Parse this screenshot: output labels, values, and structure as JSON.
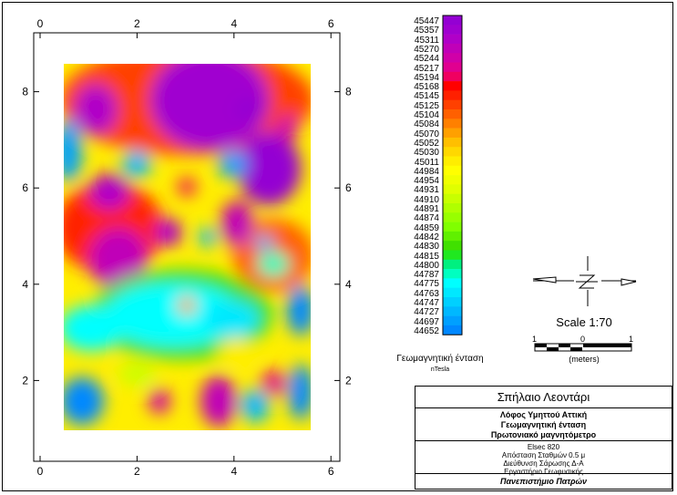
{
  "map": {
    "x_ticks": [
      "0",
      "2",
      "4",
      "6"
    ],
    "y_ticks": [
      "2",
      "4",
      "6",
      "8"
    ],
    "x_range": [
      0,
      6
    ],
    "y_range": [
      0,
      9
    ],
    "data_extent": {
      "x": [
        0.5,
        5.6
      ],
      "y": [
        0.9,
        8.6
      ]
    }
  },
  "legend": {
    "values": [
      "45447",
      "45357",
      "45311",
      "45270",
      "45244",
      "45217",
      "45194",
      "45168",
      "45145",
      "45125",
      "45104",
      "45084",
      "45070",
      "45052",
      "45030",
      "45011",
      "44984",
      "44954",
      "44931",
      "44910",
      "44891",
      "44874",
      "44859",
      "44842",
      "44830",
      "44815",
      "44800",
      "44787",
      "44775",
      "44763",
      "44747",
      "44727",
      "44697",
      "44652"
    ],
    "colors": [
      "#9400d3",
      "#a000d0",
      "#b000c8",
      "#c000b8",
      "#d000a8",
      "#e00090",
      "#f00060",
      "#ff0000",
      "#ff2000",
      "#ff4000",
      "#ff6000",
      "#ff8000",
      "#ffa000",
      "#ffbf00",
      "#ffd800",
      "#ffee00",
      "#ffff00",
      "#f0ff00",
      "#e0ff00",
      "#c8ff00",
      "#b0ff00",
      "#98ff00",
      "#80ff00",
      "#60f000",
      "#40e000",
      "#20e820",
      "#00f080",
      "#00ffc0",
      "#00ffff",
      "#00e8ff",
      "#00d0ff",
      "#00b8ff",
      "#00a0ff",
      "#0088ff"
    ],
    "title": "Γεωμαγνητική ένταση",
    "unit": "nTesla"
  },
  "north_arrow": {
    "label": "N"
  },
  "scale": {
    "text": "Scale 1:70",
    "labels": [
      "1",
      "0",
      "1"
    ],
    "unit": "(meters)"
  },
  "title_block": {
    "site": "Σπήλαιο Λεοντάρι",
    "line1": "Λόφος Υμηττού Αττική",
    "line2": "Γεωμαγνητική ένταση",
    "line3": "Πρωτονιακό μαγνητόμετρο",
    "info1": "Elsec 820",
    "info2": "Απόσταση Σταθμών 0.5 μ",
    "info3": "Διεύθυνση Σάρωσης Δ-Α",
    "info4": "Εργαστήριο Γεωφυσικής",
    "university": "Πανεπιστήμιο Πατρών"
  }
}
